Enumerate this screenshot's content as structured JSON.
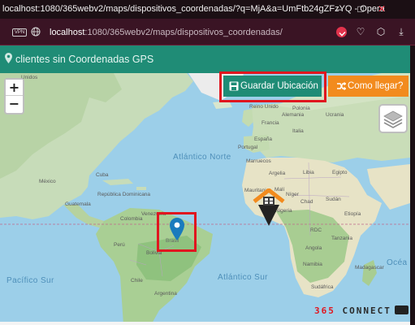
{
  "window": {
    "title": "localhost:1080/365webv2/maps/dispositivos_coordenadas/?q=MjA&a=UmFtb24gZFzYQ - Opera"
  },
  "addressbar": {
    "vpn_label": "VPN",
    "url_host": "localhost",
    "url_path": ":1080/365webv2/maps/dispositivos_coordenadas/"
  },
  "header": {
    "title": "clientes sin Coordenadas GPS"
  },
  "toolbar": {
    "save_label": "Guardar Ubicación",
    "how_label": "Como llegar?",
    "zoom_in": "+",
    "zoom_out": "−"
  },
  "map": {
    "labels": {
      "uk": "Reino Unido",
      "germany": "Alemania",
      "spain": "España",
      "france": "Francia",
      "italy": "Italia",
      "poland": "Polonia",
      "ukraine": "Ucrania",
      "portugal": "Portugal",
      "morocco": "Marruecos",
      "algeria": "Argelia",
      "libya": "Libia",
      "egypt": "Egipto",
      "mauritania": "Mauritania",
      "mali": "Malí",
      "niger": "Níger",
      "chad": "Chad",
      "sudan": "Sudán",
      "nigeria": "Nigeria",
      "ethiopia": "Etiopía",
      "drc": "RDC",
      "tanzania": "Tanzania",
      "angola": "Angola",
      "namibia": "Namibia",
      "south_africa": "Sudáfrica",
      "madagascar": "Madagascar",
      "venezuela": "Venezuela",
      "colombia": "Colombia",
      "peru": "Perú",
      "bolivia": "Bolivia",
      "chile": "Chile",
      "argentina": "Argentina",
      "brazil": "Brasil",
      "mexico": "México",
      "cuba": "Cuba",
      "guatemala": "Guatemala",
      "dominican": "República Dominicana",
      "usa": "Unidos"
    },
    "oceans": {
      "atlantic_north": "Atlántico Norte",
      "atlantic_south": "Atlántico Sur",
      "pacific_south": "Pacífico Sur",
      "indian": "Océa Índi"
    }
  },
  "footer": {
    "logo_number": "365",
    "logo_text": " CONNECT"
  },
  "colors": {
    "accent": "#1f8c76",
    "orange": "#f28b1e",
    "highlight": "#e0161f",
    "marker": "#1a7bbd"
  }
}
